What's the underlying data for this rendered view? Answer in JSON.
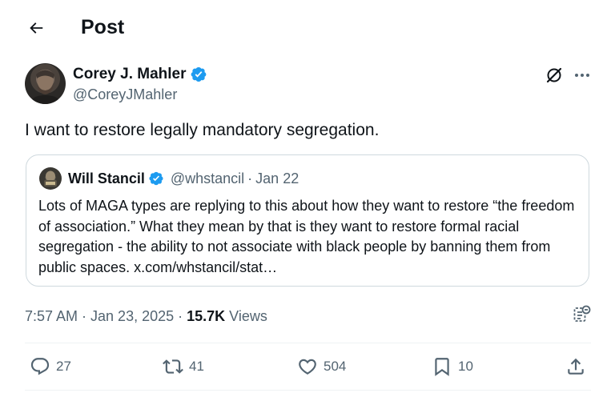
{
  "header": {
    "title": "Post",
    "back_icon": "arrow-left-icon"
  },
  "post": {
    "author_name": "Corey J. Mahler",
    "author_handle": "@CoreyJMahler",
    "verified_icon": "verified-badge-icon",
    "text": "I want to restore legally mandatory segregation.",
    "timestamp": "7:57 AM · Jan 23, 2025 · ",
    "views_count": "15.7K",
    "views_label": " Views"
  },
  "quoted_post": {
    "author_name": "Will Stancil",
    "author_handle": "@whstancil",
    "separator": " · ",
    "date": "Jan 22",
    "text": "Lots of MAGA types are replying to this about how they want to restore “the freedom of association.” What they mean by that is they want to restore formal racial segregation - the ability to not associate with black people by banning them from public spaces. x.com/whstancil/stat…"
  },
  "actions": {
    "replies": "27",
    "reposts": "41",
    "likes": "504",
    "bookmarks": "10"
  },
  "colors": {
    "text": "#0f1419",
    "secondary": "#536471",
    "verified": "#1d9bf0",
    "border": "#cfd9de"
  }
}
